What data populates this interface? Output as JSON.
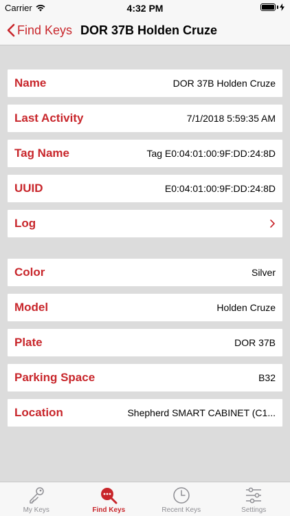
{
  "status": {
    "carrier": "Carrier",
    "time": "4:32 PM"
  },
  "nav": {
    "back_label": "Find Keys",
    "title": "DOR 37B Holden Cruze"
  },
  "rows": [
    {
      "label": "Name",
      "value": "DOR 37B Holden Cruze"
    },
    {
      "label": "Last Activity",
      "value": "7/1/2018 5:59:35 AM"
    },
    {
      "label": "Tag Name",
      "value": "Tag E0:04:01:00:9F:DD:24:8D"
    },
    {
      "label": "UUID",
      "value": "E0:04:01:00:9F:DD:24:8D"
    },
    {
      "label": "Log",
      "value": ""
    },
    {
      "label": "Color",
      "value": "Silver"
    },
    {
      "label": "Model",
      "value": "Holden Cruze"
    },
    {
      "label": "Plate",
      "value": "DOR 37B"
    },
    {
      "label": "Parking Space",
      "value": "B32"
    },
    {
      "label": "Location",
      "value": "Shepherd SMART CABINET (C1..."
    }
  ],
  "tabs": [
    {
      "label": "My Keys",
      "icon": "key-icon",
      "active": false
    },
    {
      "label": "Find Keys",
      "icon": "find-keys-icon",
      "active": true
    },
    {
      "label": "Recent Keys",
      "icon": "clock-icon",
      "active": false
    },
    {
      "label": "Settings",
      "icon": "sliders-icon",
      "active": false
    }
  ],
  "colors": {
    "accent": "#c8262b",
    "background": "#dcdcdc",
    "inactive_tab": "#8e8e93"
  }
}
